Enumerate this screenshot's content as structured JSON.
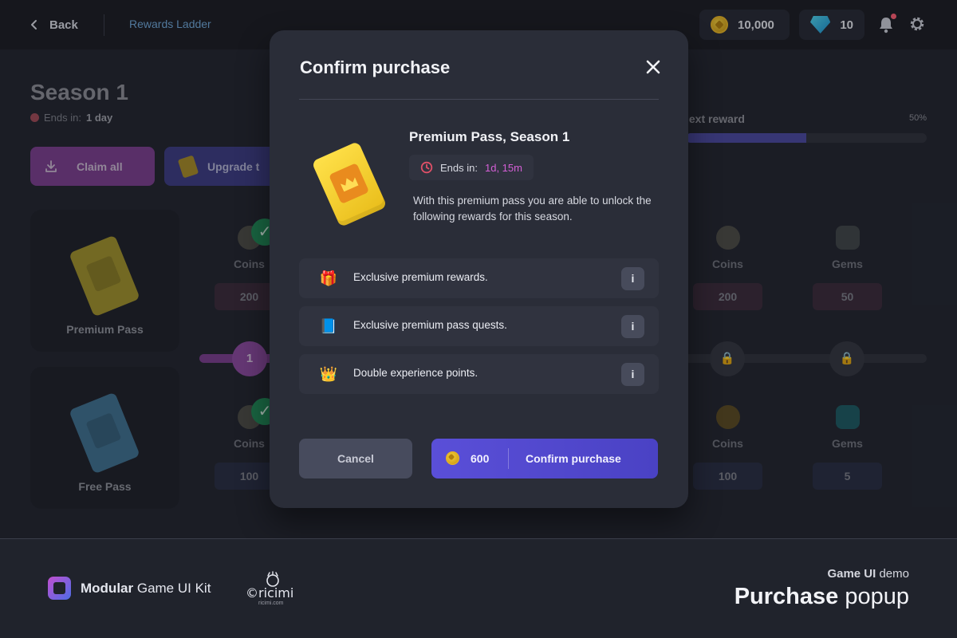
{
  "topbar": {
    "back_label": "Back",
    "breadcrumb": "Rewards Ladder",
    "coins": "10,000",
    "gems": "10"
  },
  "season": {
    "title": "Season 1",
    "ends_label": "Ends in:",
    "ends_value": "1 day",
    "claim_all": "Claim all",
    "upgrade": "Upgrade t"
  },
  "next_reward": {
    "label": "Next reward",
    "visible_label": "lext reward",
    "percent": "50%",
    "progress": 0.5
  },
  "passes": {
    "premium_label": "Premium Pass",
    "free_label": "Free Pass"
  },
  "ladder": {
    "level": "1",
    "premium_rewards": [
      {
        "name": "Coins",
        "amount": "200"
      },
      {
        "name": "Coins",
        "amount": "200"
      },
      {
        "name": "Gems",
        "amount": "50"
      }
    ],
    "free_rewards": [
      {
        "name": "Coins",
        "amount": "100"
      },
      {
        "name": "Coins",
        "amount": "100"
      },
      {
        "name": "Gems",
        "amount": "5"
      }
    ]
  },
  "modal": {
    "title": "Confirm purchase",
    "product_name": "Premium Pass, Season 1",
    "ends_label": "Ends in:",
    "ends_value": "1d, 15m",
    "description": "With this premium pass you are able to unlock the following rewards for this season.",
    "features": [
      {
        "icon": "gift-icon",
        "text": "Exclusive premium rewards."
      },
      {
        "icon": "quest-book-icon",
        "text": "Exclusive premium pass quests."
      },
      {
        "icon": "crown-icon",
        "text": "Double experience points."
      }
    ],
    "info_label": "i",
    "cancel_label": "Cancel",
    "price": "600",
    "confirm_label": "Confirm purchase"
  },
  "footer": {
    "kit_brand": "Modular",
    "kit_rest": "Game UI Kit",
    "ricimi_mark": "©ricimi",
    "ricimi_url": "ricimi.com",
    "demo_prefix": "Game UI",
    "demo_suffix": "demo",
    "title_bold": "Purchase",
    "title_rest": "popup"
  },
  "colors": {
    "accent_purple": "#5a4fd8",
    "claim_magenta": "#7a3e8f",
    "ends_value_pink": "#d45fd6",
    "modal_bg": "#2a2d38"
  }
}
